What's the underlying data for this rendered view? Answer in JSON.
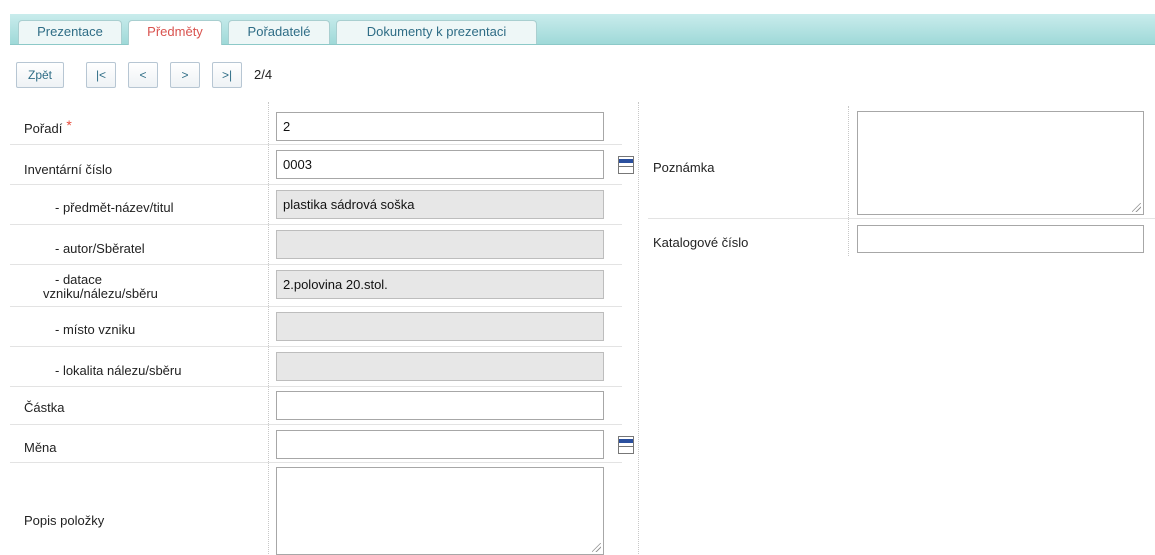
{
  "tabs": [
    {
      "label": "Prezentace",
      "active": false
    },
    {
      "label": "Předměty",
      "active": true
    },
    {
      "label": "Pořadatelé",
      "active": false
    },
    {
      "label": "Dokumenty k prezentaci",
      "active": false
    }
  ],
  "nav": {
    "back": "Zpět",
    "first": "|<",
    "prev": "<",
    "next": ">",
    "last": ">|",
    "pager": "2/4"
  },
  "form": {
    "poradi": {
      "label": "Pořadí",
      "required_mark": "*",
      "value": "2"
    },
    "inventarni_cislo": {
      "label": "Inventární číslo",
      "value": "0003"
    },
    "nazev": {
      "label": "- předmět-název/titul",
      "value": "plastika sádrová soška"
    },
    "autor": {
      "label": "- autor/Sběratel",
      "value": ""
    },
    "datace": {
      "label_line1": "- datace",
      "label_line2": "vzniku/nálezu/sběru",
      "value": "2.polovina 20.stol."
    },
    "misto": {
      "label": "- místo vzniku",
      "value": ""
    },
    "lokalita": {
      "label": "- lokalita nálezu/sběru",
      "value": ""
    },
    "castka": {
      "label": "Částka",
      "value": ""
    },
    "mena": {
      "label": "Měna",
      "value": ""
    },
    "popis": {
      "label": "Popis položky",
      "value": ""
    },
    "poznamka": {
      "label": "Poznámka",
      "value": ""
    },
    "katalogove_cislo": {
      "label": "Katalogové číslo",
      "value": ""
    }
  },
  "colors": {
    "tab_active_text": "#d9534f",
    "tab_text": "#2f6d86",
    "tabbar_bg": "#9fd9d8",
    "required": "#e74c3c",
    "readonly_bg": "#e7e7e7",
    "lookup_icon": "#2a4f9e"
  },
  "icons": {
    "lookup": "list-lookup-icon",
    "resize": "resize-grip-icon"
  }
}
